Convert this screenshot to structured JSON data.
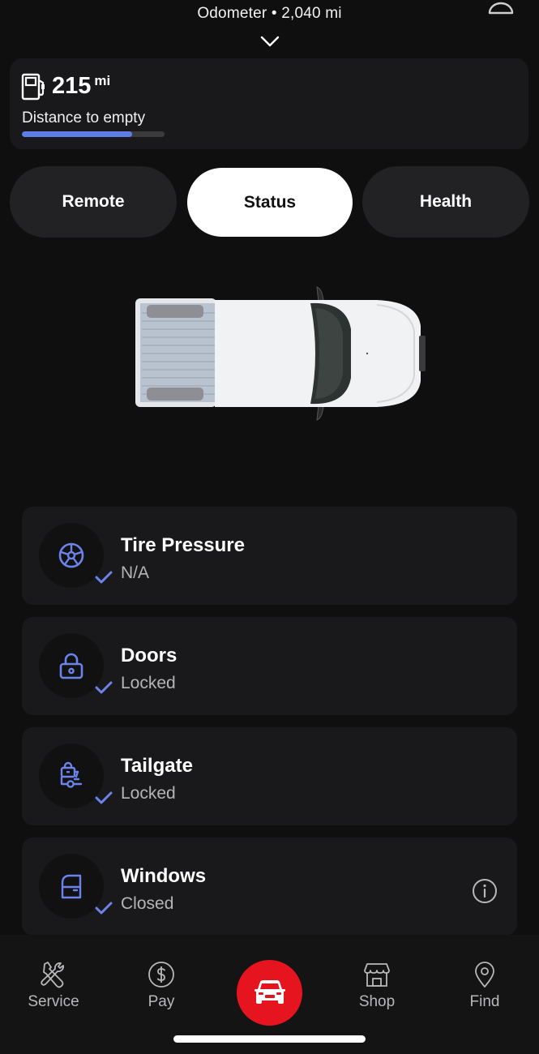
{
  "header": {
    "odometer": "Odometer • 2,040 mi"
  },
  "fuel": {
    "value": "215",
    "unit": "mi",
    "label": "Distance to empty",
    "level_percent": 77,
    "bar_color": "#5f7fe8"
  },
  "tabs": [
    {
      "label": "Remote",
      "active": false
    },
    {
      "label": "Status",
      "active": true
    },
    {
      "label": "Health",
      "active": false
    }
  ],
  "status_items": [
    {
      "icon": "tire-icon",
      "title": "Tire Pressure",
      "value": "N/A",
      "checked": true
    },
    {
      "icon": "lock-icon",
      "title": "Doors",
      "value": "Locked",
      "checked": true
    },
    {
      "icon": "tailgate-lock-icon",
      "title": "Tailgate",
      "value": "Locked",
      "checked": true
    },
    {
      "icon": "window-icon",
      "title": "Windows",
      "value": "Closed",
      "checked": true,
      "info": true
    }
  ],
  "bottom_nav": [
    {
      "icon": "wrench-screwdriver-icon",
      "label": "Service"
    },
    {
      "icon": "dollar-circle-icon",
      "label": "Pay"
    },
    {
      "icon": "car-icon",
      "label": ""
    },
    {
      "icon": "storefront-icon",
      "label": "Shop"
    },
    {
      "icon": "location-pin-icon",
      "label": "Find"
    }
  ],
  "colors": {
    "accent_blue": "#6b83ea",
    "nav_active_red": "#e6141e",
    "background": "#0f0f10",
    "card": "#19191b"
  }
}
